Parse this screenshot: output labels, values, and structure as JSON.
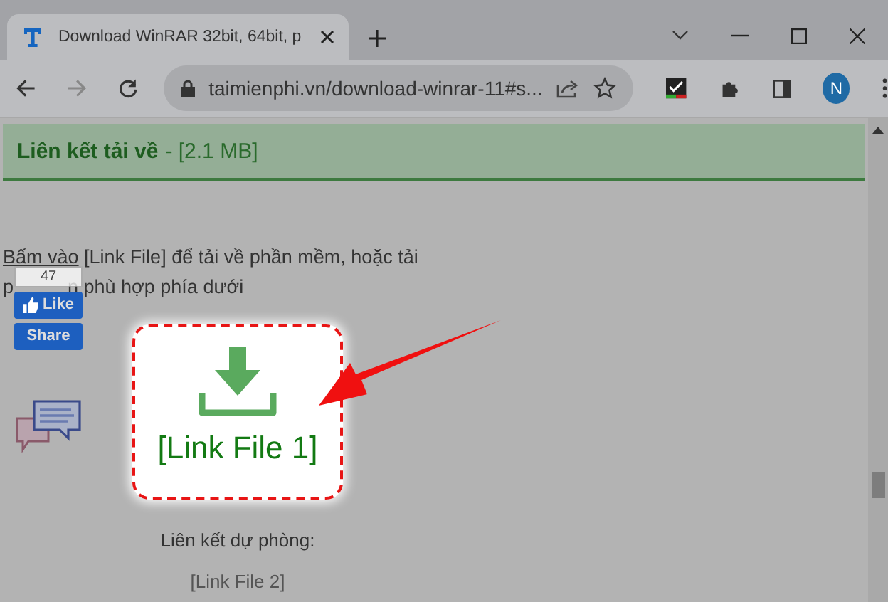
{
  "window": {
    "tab": {
      "title": "Download WinRAR 32bit, 64bit, p",
      "selected": true
    },
    "nav": {
      "back_disabled": false,
      "forward_disabled": true
    },
    "address": "taimienphi.vn/download-winrar-11#s...",
    "profile": "N"
  },
  "page": {
    "heading": "Liên kết tải về",
    "size": "- [2.1 MB]",
    "intro_link": "Bấm vào",
    "intro_rest": "[Link File] để tải về phần mềm, hoặc tải",
    "intro_line2_start": "p",
    "intro_line2_end": "n phù hợp phía dưới",
    "social": {
      "count": "47",
      "like": "Like",
      "share": "Share"
    },
    "download_label": "[Link File 1]",
    "backup_label": "Liên kết dự phòng:",
    "backup_link": "[Link File 2]"
  }
}
